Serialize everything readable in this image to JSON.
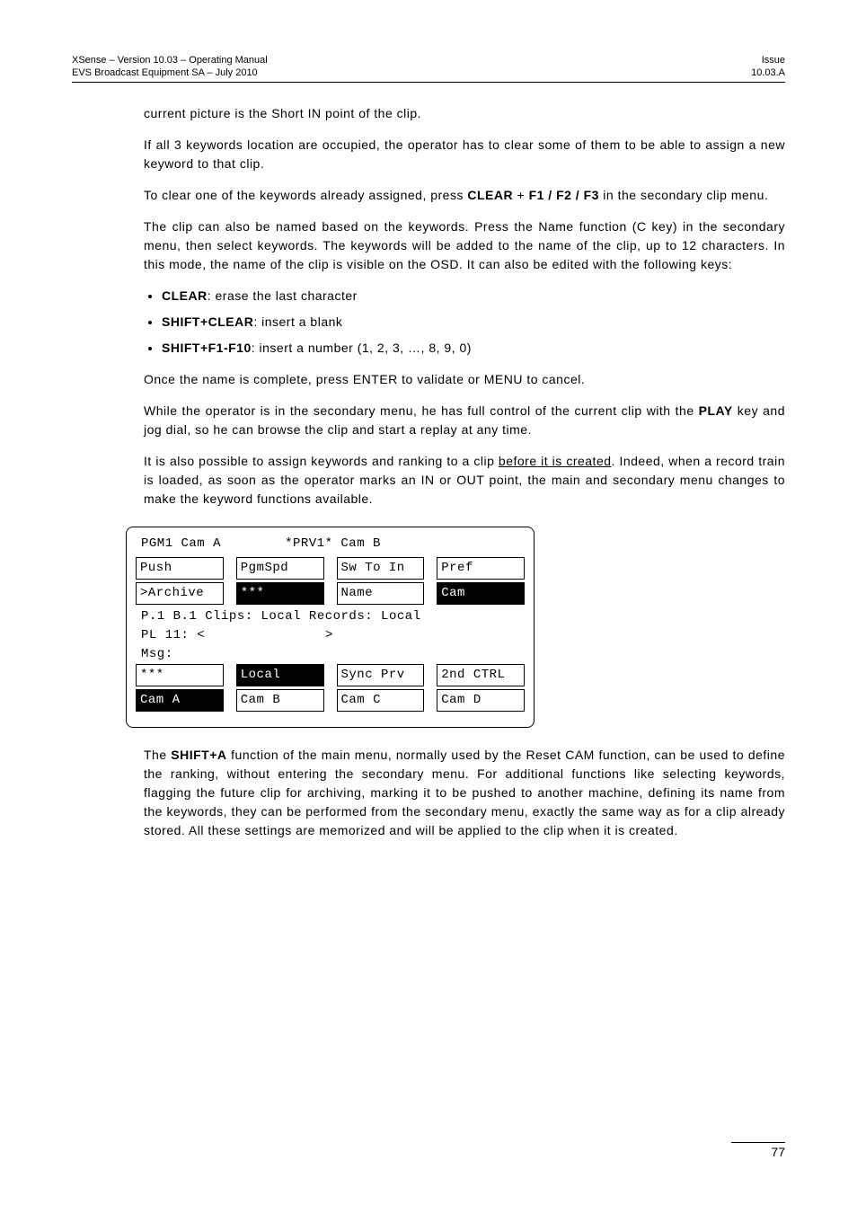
{
  "header": {
    "product_line": "XSense – Version 10.03 – Operating Manual",
    "company_line": "EVS Broadcast Equipment SA – July 2010",
    "issue_label": "Issue",
    "issue_value": "10.03.A"
  },
  "paragraphs": {
    "p1": "current picture is the Short IN point of the clip.",
    "p2": "If all 3 keywords location are occupied, the operator has to clear some of them to be able to assign a new keyword to that clip.",
    "p3_a": "To clear one of the keywords already assigned, press ",
    "p3_b_CLEAR": "CLEAR",
    "p3_c": " + ",
    "p3_d_F123": "F1 / F2 / F3",
    "p3_e": " in the secondary clip menu.",
    "p4": "The clip can also be named based on the keywords. Press the Name function (C key) in the secondary menu, then select keywords. The keywords will be added to the name of the clip, up to 12 characters. In this mode, the name of the clip is visible on the OSD. It can also be edited with the following keys:",
    "bullets": {
      "b1_strong": "CLEAR",
      "b1_rest": ": erase the last character",
      "b2_strong": "SHIFT+CLEAR",
      "b2_rest": ": insert a blank",
      "b3_strong": "SHIFT+F1-F10",
      "b3_rest": ": insert a number (1, 2, 3, …, 8, 9, 0)"
    },
    "p5": "Once the name is complete, press ENTER to validate or MENU to cancel.",
    "p6_a": "While the operator is in the secondary menu, he has full control of the current clip with the ",
    "p6_b_PLAY": "PLAY",
    "p6_c": " key and jog dial, so he can browse the clip and start a replay at any time.",
    "p7_a": "It is also possible to assign keywords and ranking to a clip ",
    "p7_b_underline": "before it is created",
    "p7_c": ". Indeed, when a record train is loaded, as soon as the operator marks an IN or OUT point, the main and secondary menu changes to make the keyword functions available.",
    "p8_a": "The ",
    "p8_b_SHIFTA": "SHIFT+A",
    "p8_c": " function of the main menu, normally used by the Reset CAM function, can be used to define the ranking, without entering the secondary menu. For additional functions like selecting keywords, flagging the future clip for archiving, marking it to be pushed to another machine, defining its name from the keywords, they can be performed from the secondary menu, exactly the same way as for a clip already stored. All these settings are memorized and will be applied to the clip when it is created."
  },
  "osd": {
    "top_left": "PGM1 Cam A",
    "top_center": "*PRV1* Cam B",
    "row1": [
      "Push",
      "PgmSpd",
      "Sw To In",
      "Pref"
    ],
    "row2": [
      ">Archive",
      "***",
      "Name",
      "Cam"
    ],
    "row2_inv": [
      false,
      true,
      false,
      true
    ],
    "line3": "P.1 B.1 Clips: Local  Records: Local",
    "line4_left": "PL 11: <",
    "line4_center": ">",
    "line5": "Msg:",
    "row3": [
      "***",
      "Local",
      "Sync Prv",
      "2nd CTRL"
    ],
    "row3_inv": [
      false,
      true,
      false,
      false
    ],
    "row4": [
      "Cam A",
      "Cam B",
      "Cam C",
      "Cam D"
    ],
    "row4_inv": [
      true,
      false,
      false,
      false
    ]
  },
  "footer": {
    "page": "77"
  }
}
